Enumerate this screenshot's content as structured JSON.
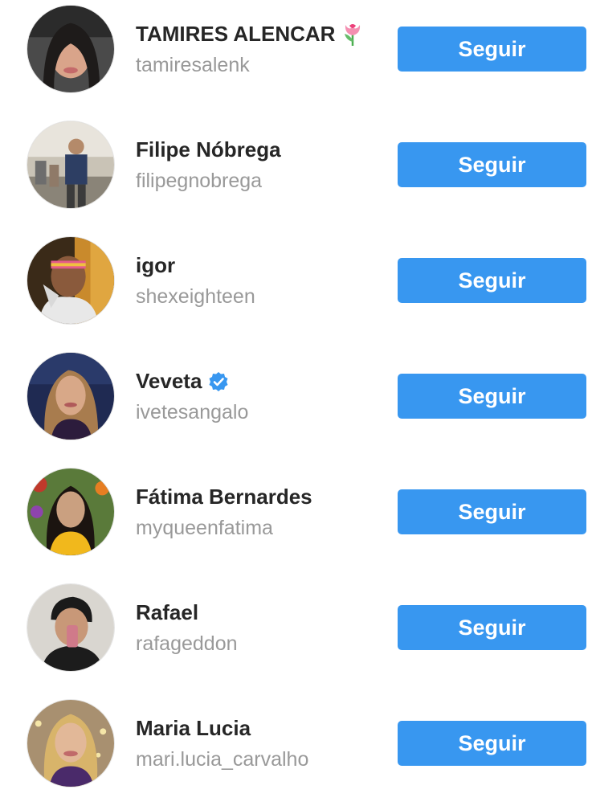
{
  "colors": {
    "button_bg": "#3897f0",
    "button_text": "#ffffff",
    "name_text": "#262626",
    "handle_text": "#999999",
    "verified": "#3897f0"
  },
  "suggestions": [
    {
      "name": "TAMIRES ALENCAR",
      "handle": "tamiresalenk",
      "button": "Seguir",
      "badge": "tulip-emoji"
    },
    {
      "name": "Filipe Nóbrega",
      "handle": "filipegnobrega",
      "button": "Seguir"
    },
    {
      "name": "igor",
      "handle": "shexeighteen",
      "button": "Seguir"
    },
    {
      "name": "Veveta",
      "handle": "ivetesangalo",
      "button": "Seguir",
      "badge": "verified-icon"
    },
    {
      "name": "Fátima Bernardes",
      "handle": "myqueenfatima",
      "button": "Seguir"
    },
    {
      "name": "Rafael",
      "handle": "rafageddon",
      "button": "Seguir"
    },
    {
      "name": "Maria Lucia",
      "handle": "mari.lucia_carvalho",
      "button": "Seguir"
    }
  ]
}
